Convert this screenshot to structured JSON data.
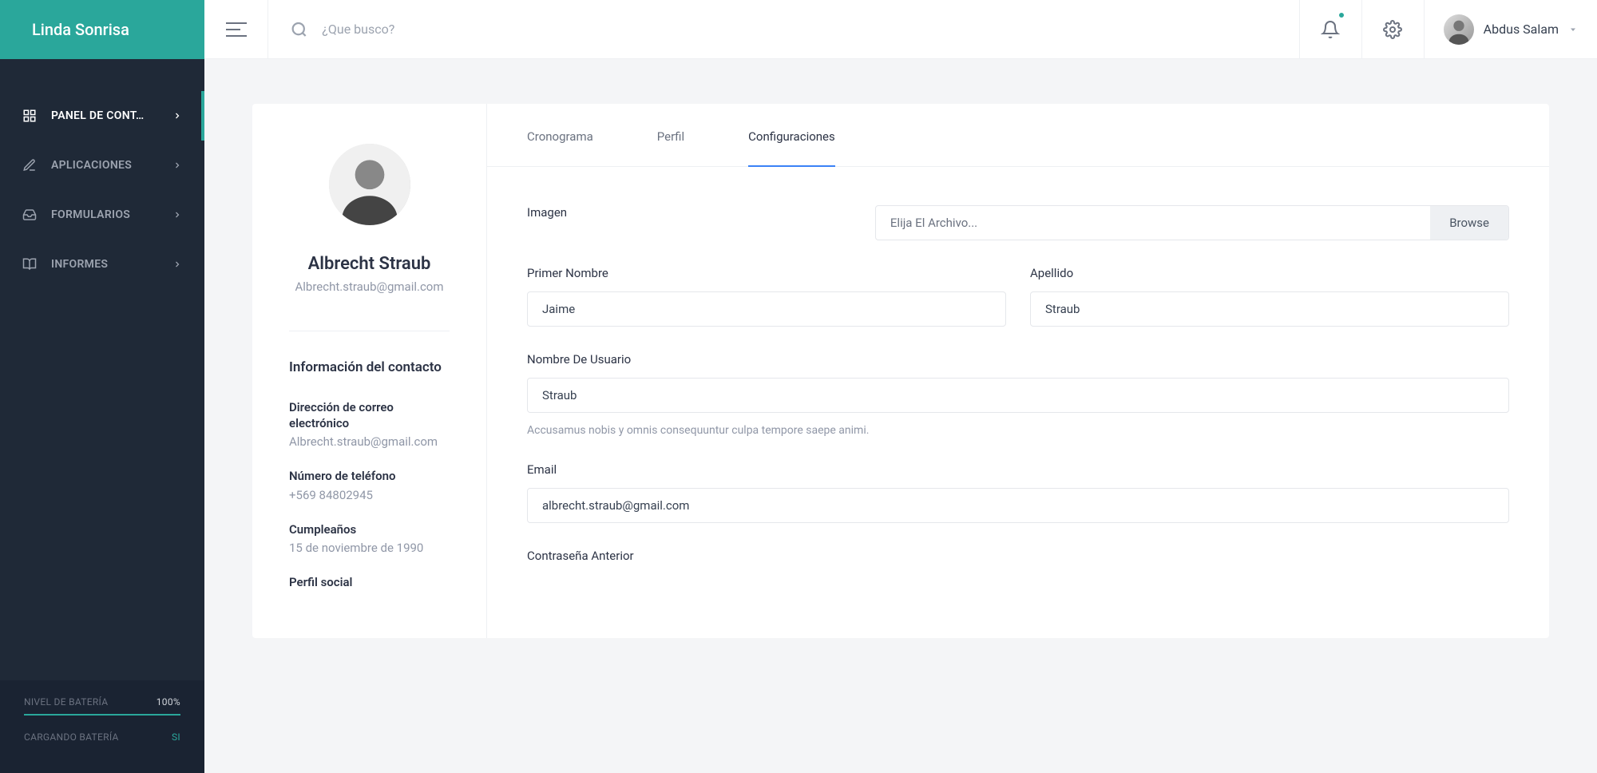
{
  "brand": "Linda Sonrisa",
  "search": {
    "placeholder": "¿Que busco?"
  },
  "topbar": {
    "user_name": "Abdus Salam"
  },
  "nav": {
    "items": [
      {
        "label": "PANEL DE CONT…",
        "active": true
      },
      {
        "label": "APLICACIONES",
        "active": false
      },
      {
        "label": "FORMULARIOS",
        "active": false
      },
      {
        "label": "INFORMES",
        "active": false
      }
    ]
  },
  "sidebar_footer": {
    "battery_level_label": "NIVEL DE BATERÍA",
    "battery_level_value": "100%",
    "charging_label": "CARGANDO BATERÍA",
    "charging_value": "SI"
  },
  "profile": {
    "name": "Albrecht Straub",
    "email": "Albrecht.straub@gmail.com",
    "contact_title": "Información del contacto",
    "email_label": "Dirección de correo electrónico",
    "email_value": "Albrecht.straub@gmail.com",
    "phone_label": "Número de teléfono",
    "phone_value": "+569 84802945",
    "birthday_label": "Cumpleaños",
    "birthday_value": "15 de noviembre de 1990",
    "social_label": "Perfil social"
  },
  "tabs": {
    "timeline": "Cronograma",
    "profile": "Perfil",
    "settings": "Configuraciones"
  },
  "form": {
    "image_label": "Imagen",
    "file_placeholder": "Elija El Archivo...",
    "browse": "Browse",
    "first_name_label": "Primer Nombre",
    "first_name_value": "Jaime",
    "last_name_label": "Apellido",
    "last_name_value": "Straub",
    "username_label": "Nombre De Usuario",
    "username_value": "Straub",
    "username_hint": "Accusamus nobis y omnis consequuntur culpa tempore saepe animi.",
    "email_label": "Email",
    "email_value": "albrecht.straub@gmail.com",
    "old_password_label": "Contraseña Anterior"
  }
}
